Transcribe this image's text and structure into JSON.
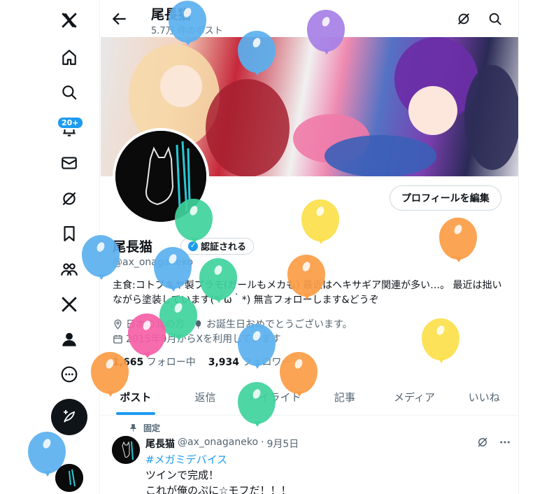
{
  "nav": {
    "notification_badge": "20+",
    "items": [
      "x-logo",
      "home",
      "explore",
      "notifications",
      "messages",
      "grok",
      "bookmarks",
      "communities",
      "premium",
      "profile",
      "more"
    ]
  },
  "header": {
    "title": "尾長猫",
    "post_count": "5.7万 件のポスト"
  },
  "profile": {
    "edit_button": "プロフィールを編集",
    "display_name": "尾長猫",
    "verify_button": "認証される",
    "handle": "@ax_onaganeko",
    "bio": "主食:コトブキヤ製プラモ(ガールもメカも) 最近はヘキサギア関連が多い…。 最近は拙いながら塗装しています(*´ω｀*) 無言フォローします&どうぞ",
    "location": "日本の北の方",
    "birthday": "お誕生日おめでとうございます。",
    "joined": "2015年9月からXを利用しています",
    "following_count": "1,665",
    "following_label": "フォロー中",
    "followers_count": "3,934",
    "followers_label": "フォロワー"
  },
  "tabs": [
    "ポスト",
    "返信",
    "ハイライト",
    "記事",
    "メディア",
    "いいね"
  ],
  "active_tab": 0,
  "post": {
    "pinned_label": "固定",
    "author": "尾長猫",
    "handle": "@ax_onaganeko",
    "separator": "·",
    "date": "9月5日",
    "hashtag": "#メガミデバイス",
    "line1": "ツインで完成！",
    "line2": "これが俺のぷに☆モフだ！！！"
  },
  "colors": {
    "accent": "#1d9bf0",
    "balloon_blue": "#5ab0ef",
    "balloon_purple": "#a67fe6",
    "balloon_green": "#3fd39d",
    "balloon_yellow": "#fbe04a",
    "balloon_orange": "#fb9c45",
    "balloon_pink": "#f55fa6"
  }
}
